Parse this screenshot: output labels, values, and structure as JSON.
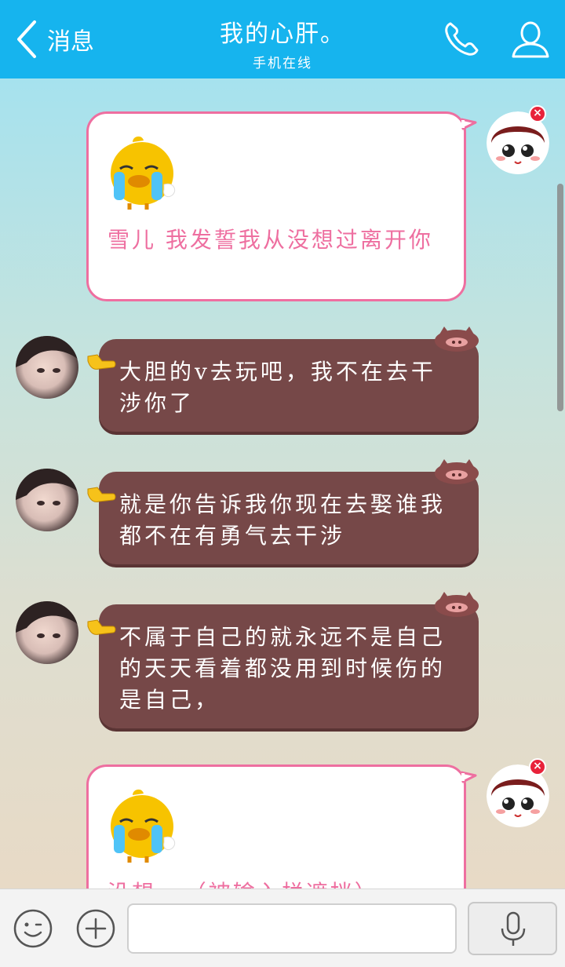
{
  "header": {
    "back_label": "消息",
    "title": "我的心肝。",
    "subtitle": "手机在线",
    "bg_color": "#16b4ee",
    "call_icon": "phone-icon",
    "profile_icon": "person-icon"
  },
  "messages": [
    {
      "direction": "out",
      "sticker": "crying-duck-sticker",
      "text": "雪儿   我发誓我从没想过离开你"
    },
    {
      "direction": "in",
      "text": "大胆的v去玩吧，我不在去干涉你了"
    },
    {
      "direction": "in",
      "text": "就是你告诉我你现在去娶谁我都不在有勇气去干涉"
    },
    {
      "direction": "in",
      "text": "不属于自己的就永远不是自己的天天看着都没用到时候伤的是自己，"
    },
    {
      "direction": "out",
      "sticker": "crying-duck-sticker",
      "text": "没想...（被输入栏遮挡）"
    }
  ],
  "input": {
    "placeholder": "",
    "emoji_icon": "emoji-icon",
    "plus_icon": "plus-icon",
    "voice_icon": "microphone-icon"
  },
  "colors": {
    "out_bubble_border": "#ee6fa0",
    "out_text": "#ee6fa0",
    "in_bubble": "#764848"
  }
}
